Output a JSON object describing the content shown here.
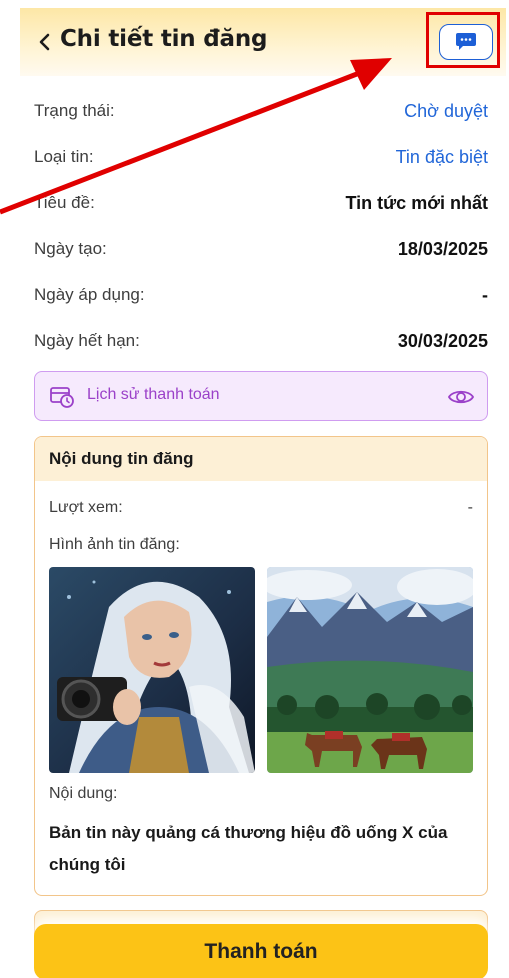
{
  "header": {
    "title": "Chi tiết tin đăng",
    "back_icon": "chevron-left-icon",
    "chat_icon": "chat-bubble-icon"
  },
  "details": [
    {
      "label": "Trạng thái:",
      "value": "Chờ duyệt",
      "style": "blue"
    },
    {
      "label": "Loại tin:",
      "value": "Tin đặc biệt",
      "style": "blue"
    },
    {
      "label": "Tiêu đề:",
      "value": "Tin tức mới nhất",
      "style": "normal"
    },
    {
      "label": "Ngày tạo:",
      "value": "18/03/2025",
      "style": "dark"
    },
    {
      "label": "Ngày áp dụng:",
      "value": "-",
      "style": "normal"
    },
    {
      "label": "Ngày hết hạn:",
      "value": "30/03/2025",
      "style": "dark"
    }
  ],
  "payment_history": {
    "label": "Lịch sử thanh toán",
    "icon": "card-clock-icon",
    "view_icon": "eye-icon"
  },
  "post_content": {
    "heading": "Nội dung tin đăng",
    "views_label": "Lượt xem:",
    "views_value": "-",
    "images_label": "Hình ảnh tin đăng:",
    "images": [
      "warrior-woman-with-camera-image",
      "mountain-horses-image"
    ],
    "content_label": "Nội dung:",
    "content_text": "Bản tin này quảng cá thương hiệu đồ uống X của chúng tôi"
  },
  "actions": {
    "pay_label": "Thanh toán"
  },
  "colors": {
    "accent_blue": "#2166d8",
    "accent_purple": "#9b41c9",
    "button_yellow": "#fcc316",
    "annotation_red": "#e00000"
  }
}
